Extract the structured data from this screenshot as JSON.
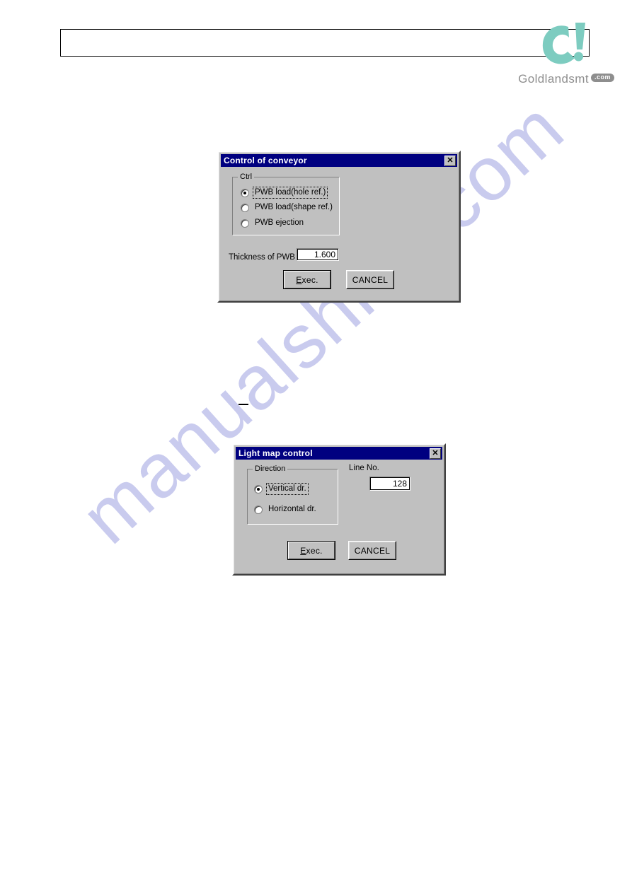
{
  "page": {
    "watermark_text": "manualshive.com",
    "header_box_present": true,
    "body_dash_mark": "—"
  },
  "brand": {
    "logo_glyph": "c!",
    "logo_color": "#7dccc0",
    "wordmark": "Goldlandsmt",
    "wordmark_badge": ".com",
    "wordmark_color": "#8e8e8e"
  },
  "dialogs": [
    {
      "id": "control-of-conveyor",
      "title": "Control of conveyor",
      "close_label": "✕",
      "titlebar_color": "#000080",
      "face_color": "#c0c0c0",
      "group": {
        "label": "Ctrl",
        "options": [
          {
            "label": "PWB load(hole ref.)",
            "selected": true,
            "focused": true
          },
          {
            "label": "PWB load(shape ref.)",
            "selected": false,
            "focused": false
          },
          {
            "label": "PWB ejection",
            "selected": false,
            "focused": false
          }
        ]
      },
      "field": {
        "label": "Thickness of PWB",
        "value": "1.600"
      },
      "buttons": {
        "exec_prefix": "E",
        "exec_suffix": "xec.",
        "cancel": "CANCEL"
      }
    },
    {
      "id": "light-map-control",
      "title": "Light map control",
      "close_label": "✕",
      "titlebar_color": "#000080",
      "face_color": "#c0c0c0",
      "group": {
        "label": "Direction",
        "options": [
          {
            "label": "Vertical dr.",
            "selected": true,
            "focused": true
          },
          {
            "label": "Horizontal dr.",
            "selected": false,
            "focused": false
          }
        ]
      },
      "field": {
        "label": "Line No.",
        "value": "128"
      },
      "buttons": {
        "exec_prefix": "E",
        "exec_suffix": "xec.",
        "cancel": "CANCEL"
      }
    }
  ]
}
